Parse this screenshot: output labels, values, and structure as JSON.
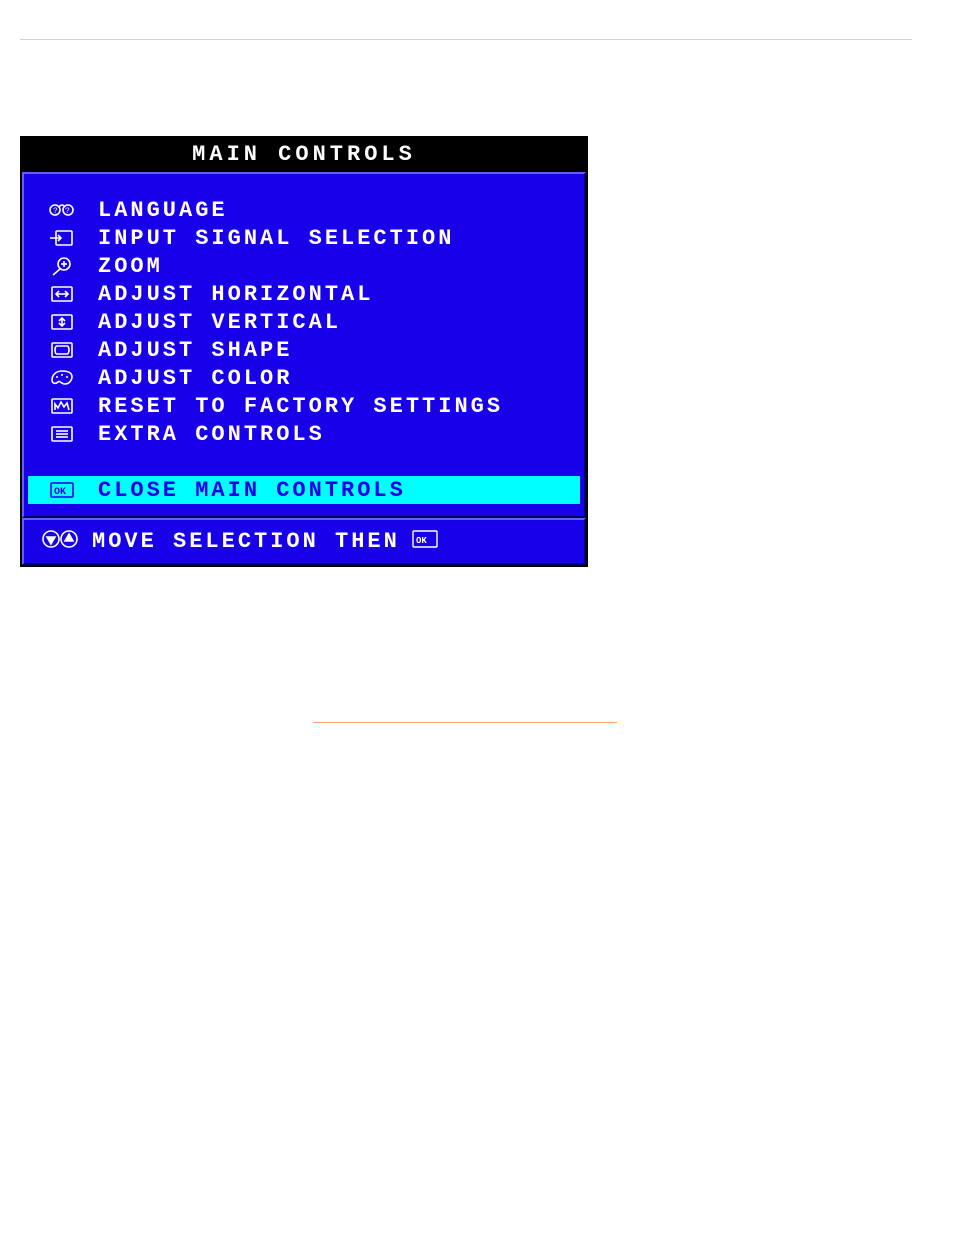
{
  "osd": {
    "title": "MAIN CONTROLS",
    "items": [
      {
        "label": "LANGUAGE",
        "icon": "language-icon"
      },
      {
        "label": "INPUT SIGNAL SELECTION",
        "icon": "input-signal-icon"
      },
      {
        "label": "ZOOM",
        "icon": "zoom-icon"
      },
      {
        "label": "ADJUST HORIZONTAL",
        "icon": "adjust-horizontal-icon"
      },
      {
        "label": "ADJUST VERTICAL",
        "icon": "adjust-vertical-icon"
      },
      {
        "label": "ADJUST SHAPE",
        "icon": "adjust-shape-icon"
      },
      {
        "label": "ADJUST COLOR",
        "icon": "adjust-color-icon"
      },
      {
        "label": "RESET TO FACTORY SETTINGS",
        "icon": "factory-reset-icon"
      },
      {
        "label": "EXTRA CONTROLS",
        "icon": "extra-controls-icon"
      }
    ],
    "selected": {
      "label": "CLOSE MAIN CONTROLS",
      "icon": "ok-icon"
    },
    "footer_text": "MOVE SELECTION THEN",
    "colors": {
      "background": "#1800e8",
      "highlight": "#00ffff",
      "text": "#ffffff",
      "title_bg": "#000000"
    }
  }
}
